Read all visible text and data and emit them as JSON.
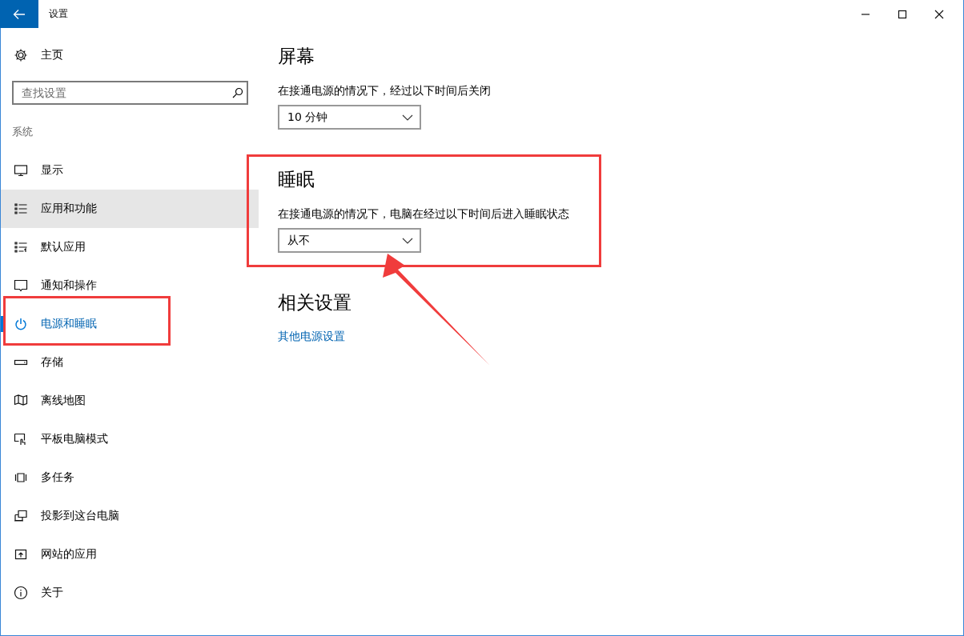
{
  "window": {
    "title": "设置"
  },
  "sidebar": {
    "home": "主页",
    "search": {
      "placeholder": "查找设置"
    },
    "section": "系统",
    "items": [
      {
        "label": "显示",
        "selected": false,
        "hovered": false
      },
      {
        "label": "应用和功能",
        "selected": false,
        "hovered": true
      },
      {
        "label": "默认应用",
        "selected": false,
        "hovered": false
      },
      {
        "label": "通知和操作",
        "selected": false,
        "hovered": false
      },
      {
        "label": "电源和睡眠",
        "selected": true,
        "hovered": false
      },
      {
        "label": "存储",
        "selected": false,
        "hovered": false
      },
      {
        "label": "离线地图",
        "selected": false,
        "hovered": false
      },
      {
        "label": "平板电脑模式",
        "selected": false,
        "hovered": false
      },
      {
        "label": "多任务",
        "selected": false,
        "hovered": false
      },
      {
        "label": "投影到这台电脑",
        "selected": false,
        "hovered": false
      },
      {
        "label": "网站的应用",
        "selected": false,
        "hovered": false
      },
      {
        "label": "关于",
        "selected": false,
        "hovered": false
      }
    ]
  },
  "sections": [
    {
      "kind": "setting",
      "title": "屏幕",
      "description": "在接通电源的情况下，经过以下时间后关闭",
      "value": "10 分钟"
    },
    {
      "kind": "setting",
      "title": "睡眠",
      "description": "在接通电源的情况下，电脑在经过以下时间后进入睡眠状态",
      "value": "从不"
    },
    {
      "kind": "links",
      "title": "相关设置",
      "link": "其他电源设置"
    }
  ]
}
